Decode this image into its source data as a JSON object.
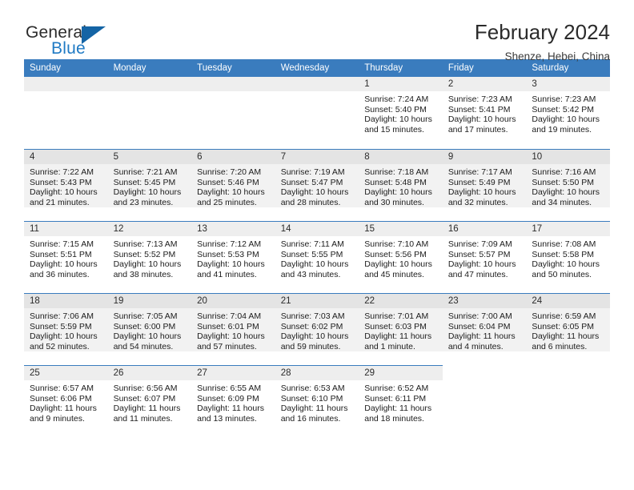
{
  "brand": {
    "name_part1": "General",
    "name_part2": "Blue",
    "triangle_color": "#1464a5",
    "blue_color": "#1f7ac4"
  },
  "header": {
    "title": "February 2024",
    "subtitle": "Shenze, Hebei, China"
  },
  "theme": {
    "header_band": "#3a7cbe",
    "daynum_band": "#eeeeee",
    "shaded_row": "#f2f2f2"
  },
  "weekdays": [
    "Sunday",
    "Monday",
    "Tuesday",
    "Wednesday",
    "Thursday",
    "Friday",
    "Saturday"
  ],
  "labels": {
    "sunrise": "Sunrise:",
    "sunset": "Sunset:",
    "daylight": "Daylight:"
  },
  "weeks": [
    {
      "shaded": false,
      "days": [
        {
          "empty": true
        },
        {
          "empty": true
        },
        {
          "empty": true
        },
        {
          "empty": true
        },
        {
          "date": "1",
          "sunrise": "Sunrise: 7:24 AM",
          "sunset": "Sunset: 5:40 PM",
          "daylight1": "Daylight: 10 hours",
          "daylight2": "and 15 minutes."
        },
        {
          "date": "2",
          "sunrise": "Sunrise: 7:23 AM",
          "sunset": "Sunset: 5:41 PM",
          "daylight1": "Daylight: 10 hours",
          "daylight2": "and 17 minutes."
        },
        {
          "date": "3",
          "sunrise": "Sunrise: 7:23 AM",
          "sunset": "Sunset: 5:42 PM",
          "daylight1": "Daylight: 10 hours",
          "daylight2": "and 19 minutes."
        }
      ]
    },
    {
      "shaded": true,
      "days": [
        {
          "date": "4",
          "sunrise": "Sunrise: 7:22 AM",
          "sunset": "Sunset: 5:43 PM",
          "daylight1": "Daylight: 10 hours",
          "daylight2": "and 21 minutes."
        },
        {
          "date": "5",
          "sunrise": "Sunrise: 7:21 AM",
          "sunset": "Sunset: 5:45 PM",
          "daylight1": "Daylight: 10 hours",
          "daylight2": "and 23 minutes."
        },
        {
          "date": "6",
          "sunrise": "Sunrise: 7:20 AM",
          "sunset": "Sunset: 5:46 PM",
          "daylight1": "Daylight: 10 hours",
          "daylight2": "and 25 minutes."
        },
        {
          "date": "7",
          "sunrise": "Sunrise: 7:19 AM",
          "sunset": "Sunset: 5:47 PM",
          "daylight1": "Daylight: 10 hours",
          "daylight2": "and 28 minutes."
        },
        {
          "date": "8",
          "sunrise": "Sunrise: 7:18 AM",
          "sunset": "Sunset: 5:48 PM",
          "daylight1": "Daylight: 10 hours",
          "daylight2": "and 30 minutes."
        },
        {
          "date": "9",
          "sunrise": "Sunrise: 7:17 AM",
          "sunset": "Sunset: 5:49 PM",
          "daylight1": "Daylight: 10 hours",
          "daylight2": "and 32 minutes."
        },
        {
          "date": "10",
          "sunrise": "Sunrise: 7:16 AM",
          "sunset": "Sunset: 5:50 PM",
          "daylight1": "Daylight: 10 hours",
          "daylight2": "and 34 minutes."
        }
      ]
    },
    {
      "shaded": false,
      "days": [
        {
          "date": "11",
          "sunrise": "Sunrise: 7:15 AM",
          "sunset": "Sunset: 5:51 PM",
          "daylight1": "Daylight: 10 hours",
          "daylight2": "and 36 minutes."
        },
        {
          "date": "12",
          "sunrise": "Sunrise: 7:13 AM",
          "sunset": "Sunset: 5:52 PM",
          "daylight1": "Daylight: 10 hours",
          "daylight2": "and 38 minutes."
        },
        {
          "date": "13",
          "sunrise": "Sunrise: 7:12 AM",
          "sunset": "Sunset: 5:53 PM",
          "daylight1": "Daylight: 10 hours",
          "daylight2": "and 41 minutes."
        },
        {
          "date": "14",
          "sunrise": "Sunrise: 7:11 AM",
          "sunset": "Sunset: 5:55 PM",
          "daylight1": "Daylight: 10 hours",
          "daylight2": "and 43 minutes."
        },
        {
          "date": "15",
          "sunrise": "Sunrise: 7:10 AM",
          "sunset": "Sunset: 5:56 PM",
          "daylight1": "Daylight: 10 hours",
          "daylight2": "and 45 minutes."
        },
        {
          "date": "16",
          "sunrise": "Sunrise: 7:09 AM",
          "sunset": "Sunset: 5:57 PM",
          "daylight1": "Daylight: 10 hours",
          "daylight2": "and 47 minutes."
        },
        {
          "date": "17",
          "sunrise": "Sunrise: 7:08 AM",
          "sunset": "Sunset: 5:58 PM",
          "daylight1": "Daylight: 10 hours",
          "daylight2": "and 50 minutes."
        }
      ]
    },
    {
      "shaded": true,
      "days": [
        {
          "date": "18",
          "sunrise": "Sunrise: 7:06 AM",
          "sunset": "Sunset: 5:59 PM",
          "daylight1": "Daylight: 10 hours",
          "daylight2": "and 52 minutes."
        },
        {
          "date": "19",
          "sunrise": "Sunrise: 7:05 AM",
          "sunset": "Sunset: 6:00 PM",
          "daylight1": "Daylight: 10 hours",
          "daylight2": "and 54 minutes."
        },
        {
          "date": "20",
          "sunrise": "Sunrise: 7:04 AM",
          "sunset": "Sunset: 6:01 PM",
          "daylight1": "Daylight: 10 hours",
          "daylight2": "and 57 minutes."
        },
        {
          "date": "21",
          "sunrise": "Sunrise: 7:03 AM",
          "sunset": "Sunset: 6:02 PM",
          "daylight1": "Daylight: 10 hours",
          "daylight2": "and 59 minutes."
        },
        {
          "date": "22",
          "sunrise": "Sunrise: 7:01 AM",
          "sunset": "Sunset: 6:03 PM",
          "daylight1": "Daylight: 11 hours",
          "daylight2": "and 1 minute."
        },
        {
          "date": "23",
          "sunrise": "Sunrise: 7:00 AM",
          "sunset": "Sunset: 6:04 PM",
          "daylight1": "Daylight: 11 hours",
          "daylight2": "and 4 minutes."
        },
        {
          "date": "24",
          "sunrise": "Sunrise: 6:59 AM",
          "sunset": "Sunset: 6:05 PM",
          "daylight1": "Daylight: 11 hours",
          "daylight2": "and 6 minutes."
        }
      ]
    },
    {
      "shaded": false,
      "days": [
        {
          "date": "25",
          "sunrise": "Sunrise: 6:57 AM",
          "sunset": "Sunset: 6:06 PM",
          "daylight1": "Daylight: 11 hours",
          "daylight2": "and 9 minutes."
        },
        {
          "date": "26",
          "sunrise": "Sunrise: 6:56 AM",
          "sunset": "Sunset: 6:07 PM",
          "daylight1": "Daylight: 11 hours",
          "daylight2": "and 11 minutes."
        },
        {
          "date": "27",
          "sunrise": "Sunrise: 6:55 AM",
          "sunset": "Sunset: 6:09 PM",
          "daylight1": "Daylight: 11 hours",
          "daylight2": "and 13 minutes."
        },
        {
          "date": "28",
          "sunrise": "Sunrise: 6:53 AM",
          "sunset": "Sunset: 6:10 PM",
          "daylight1": "Daylight: 11 hours",
          "daylight2": "and 16 minutes."
        },
        {
          "date": "29",
          "sunrise": "Sunrise: 6:52 AM",
          "sunset": "Sunset: 6:11 PM",
          "daylight1": "Daylight: 11 hours",
          "daylight2": "and 18 minutes."
        },
        {
          "empty": true,
          "no_border": true
        },
        {
          "empty": true,
          "no_border": true
        }
      ]
    }
  ]
}
